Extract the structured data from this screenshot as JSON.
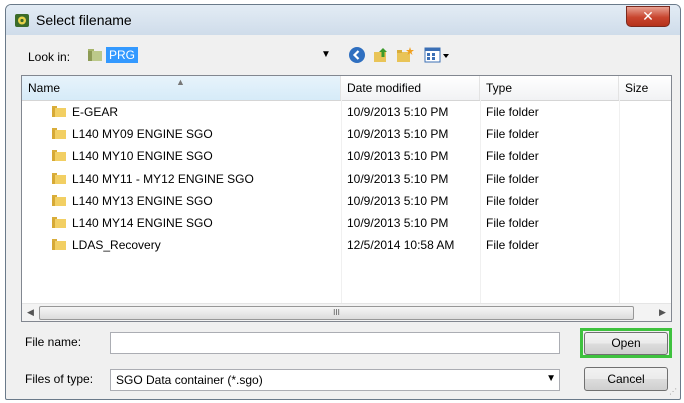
{
  "window": {
    "title": "Select filename",
    "close_symbol": "✕"
  },
  "toolbar": {
    "look_in_label": "Look in:",
    "look_in_value": "PRG",
    "dropdown_arrow": "▼"
  },
  "list": {
    "columns": [
      "Name",
      "Date modified",
      "Type",
      "Size"
    ],
    "rows": [
      {
        "name": "E-GEAR",
        "date": "10/9/2013 5:10 PM",
        "type": "File folder"
      },
      {
        "name": "L140 MY09 ENGINE SGO",
        "date": "10/9/2013 5:10 PM",
        "type": "File folder"
      },
      {
        "name": "L140 MY10 ENGINE SGO",
        "date": "10/9/2013 5:10 PM",
        "type": "File folder"
      },
      {
        "name": "L140 MY11 - MY12  ENGINE SGO",
        "date": "10/9/2013 5:10 PM",
        "type": "File folder"
      },
      {
        "name": "L140 MY13 ENGINE SGO",
        "date": "10/9/2013 5:10 PM",
        "type": "File folder"
      },
      {
        "name": "L140 MY14 ENGINE SGO",
        "date": "10/9/2013 5:10 PM",
        "type": "File folder"
      },
      {
        "name": "LDAS_Recovery",
        "date": "12/5/2014 10:58 AM",
        "type": "File folder"
      }
    ],
    "scroll_grip": "III"
  },
  "form": {
    "file_name_label": "File name:",
    "file_name_value": "",
    "file_type_label": "Files of type:",
    "file_type_value": "SGO Data container (*.sgo)",
    "open_label": "Open",
    "cancel_label": "Cancel"
  },
  "colors": {
    "selection": "#3399ff",
    "highlight_border": "#3ec23e",
    "close_button": "#c8452e"
  }
}
